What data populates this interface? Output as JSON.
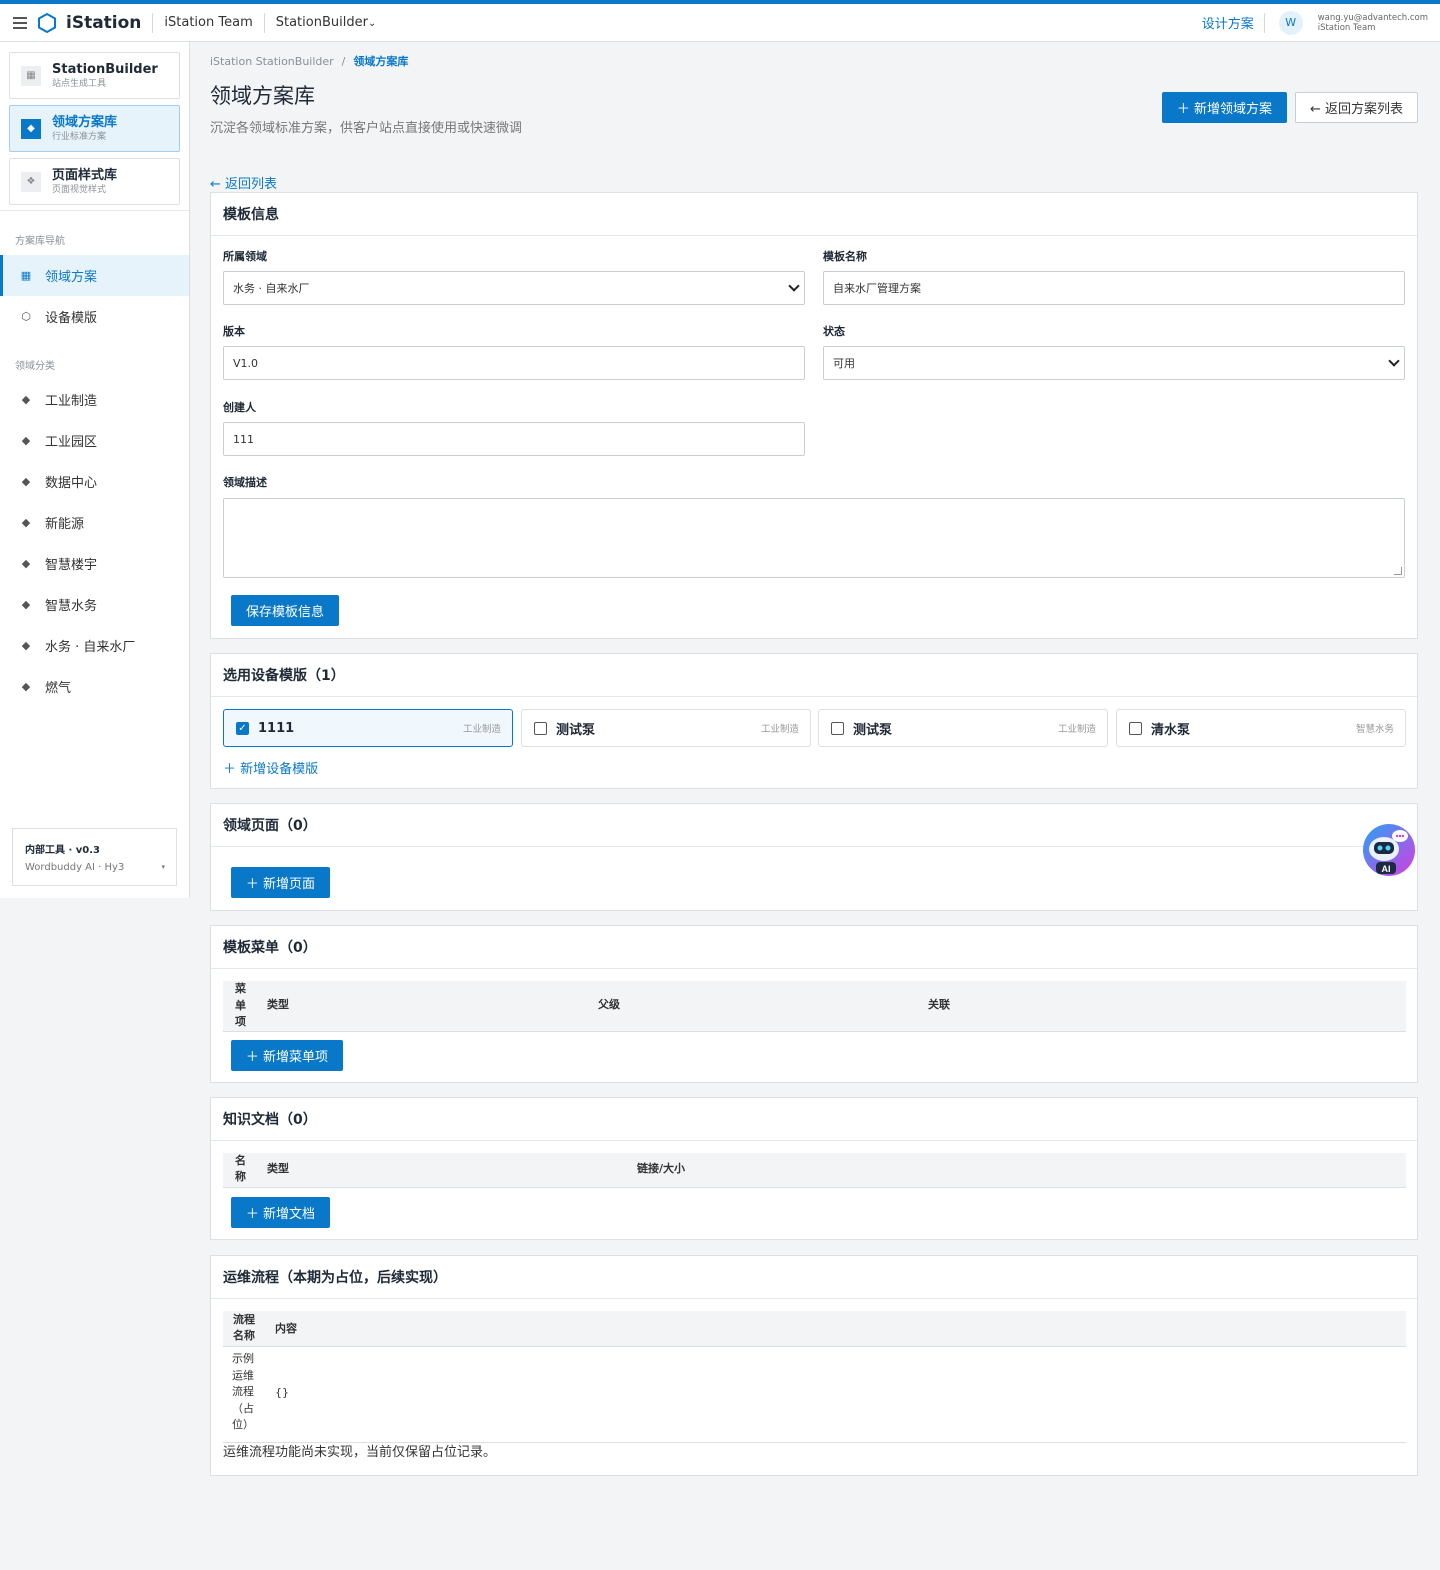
{
  "topbar": {
    "brand": "iStation",
    "team": "iStation Team",
    "app_switch": "StationBuilder",
    "design_link": "设计方案",
    "avatar": "W",
    "user_email": "wang.yu@advantech.com",
    "user_team": "iStation Team"
  },
  "sidebar": {
    "apps": [
      {
        "title": "StationBuilder",
        "subtitle": "站点生成工具",
        "icon": "grid-icon",
        "glyph": "▦"
      },
      {
        "title": "领域方案库",
        "subtitle": "行业标准方案",
        "icon": "diamond-icon",
        "glyph": "◆"
      },
      {
        "title": "页面样式库",
        "subtitle": "页面视觉样式",
        "icon": "style-icon",
        "glyph": "❖"
      }
    ],
    "nav_section": "方案库导航",
    "nav": [
      {
        "label": "领域方案",
        "icon": "grid-icon",
        "glyph": "▦",
        "active": true
      },
      {
        "label": "设备模版",
        "icon": "hexagon-icon",
        "glyph": "⬡",
        "active": false
      }
    ],
    "category_section": "领域分类",
    "categories": [
      {
        "label": "工业制造",
        "glyph": "◆"
      },
      {
        "label": "工业园区",
        "glyph": "◆"
      },
      {
        "label": "数据中心",
        "glyph": "◆"
      },
      {
        "label": "新能源",
        "glyph": "◆"
      },
      {
        "label": "智慧楼宇",
        "glyph": "◆"
      },
      {
        "label": "智慧水务",
        "glyph": "◆"
      },
      {
        "label": "水务 · 自来水厂",
        "glyph": "◆"
      },
      {
        "label": "燃气",
        "glyph": "◆"
      }
    ],
    "tool": {
      "title": "内部工具 · v0.3",
      "subtitle": "Wordbuddy AI · Hy3",
      "caret": "▾"
    }
  },
  "header": {
    "breadcrumb_root": "iStation StationBuilder",
    "breadcrumb_sep": "/",
    "breadcrumb_current": "领域方案库",
    "title": "领域方案库",
    "subtitle": "沉淀各领域标准方案，供客户站点直接使用或快速微调",
    "add_button": "＋ 新增领域方案",
    "back_button": "← 返回方案列表",
    "back_link": "← 返回列表"
  },
  "template_info": {
    "heading": "模板信息",
    "domain_label": "所属领域",
    "domain_value": "水务 · 自来水厂",
    "name_label": "模板名称",
    "name_value": "自来水厂管理方案",
    "version_label": "版本",
    "version_value": "V1.0",
    "status_label": "状态",
    "status_value": "可用",
    "creator_label": "创建人",
    "creator_value": "111",
    "desc_label": "领域描述",
    "desc_value": "",
    "save_button": "保存模板信息"
  },
  "devices": {
    "heading": "选用设备模版（1）",
    "items": [
      {
        "name": "1111",
        "tag": "工业制造",
        "checked": true
      },
      {
        "name": "测试泵",
        "tag": "工业制造",
        "checked": false
      },
      {
        "name": "测试泵",
        "tag": "工业制造",
        "checked": false
      },
      {
        "name": "清水泵",
        "tag": "智慧水务",
        "checked": false
      }
    ],
    "add_link": "＋ 新增设备模版"
  },
  "pages": {
    "heading": "领域页面（0）",
    "add_button": "＋ 新增页面"
  },
  "menus": {
    "heading": "模板菜单（0）",
    "columns": [
      "菜单项",
      "类型",
      "父级",
      "关联"
    ],
    "add_button": "＋ 新增菜单项"
  },
  "docs": {
    "heading": "知识文档（0）",
    "columns": [
      "名称",
      "类型",
      "链接/大小"
    ],
    "add_button": "＋ 新增文档"
  },
  "ops": {
    "heading": "运维流程（本期为占位，后续实现）",
    "columns": [
      "流程名称",
      "内容"
    ],
    "rows": [
      {
        "name": "示例运维流程（占位）",
        "content": "{}"
      }
    ],
    "note": "运维流程功能尚未实现，当前仅保留占位记录。"
  },
  "ai_bot": {
    "label": "AI"
  },
  "colors": {
    "accent": "#0a78c9",
    "background": "#f3f4f6",
    "border": "#dcdfe4"
  }
}
